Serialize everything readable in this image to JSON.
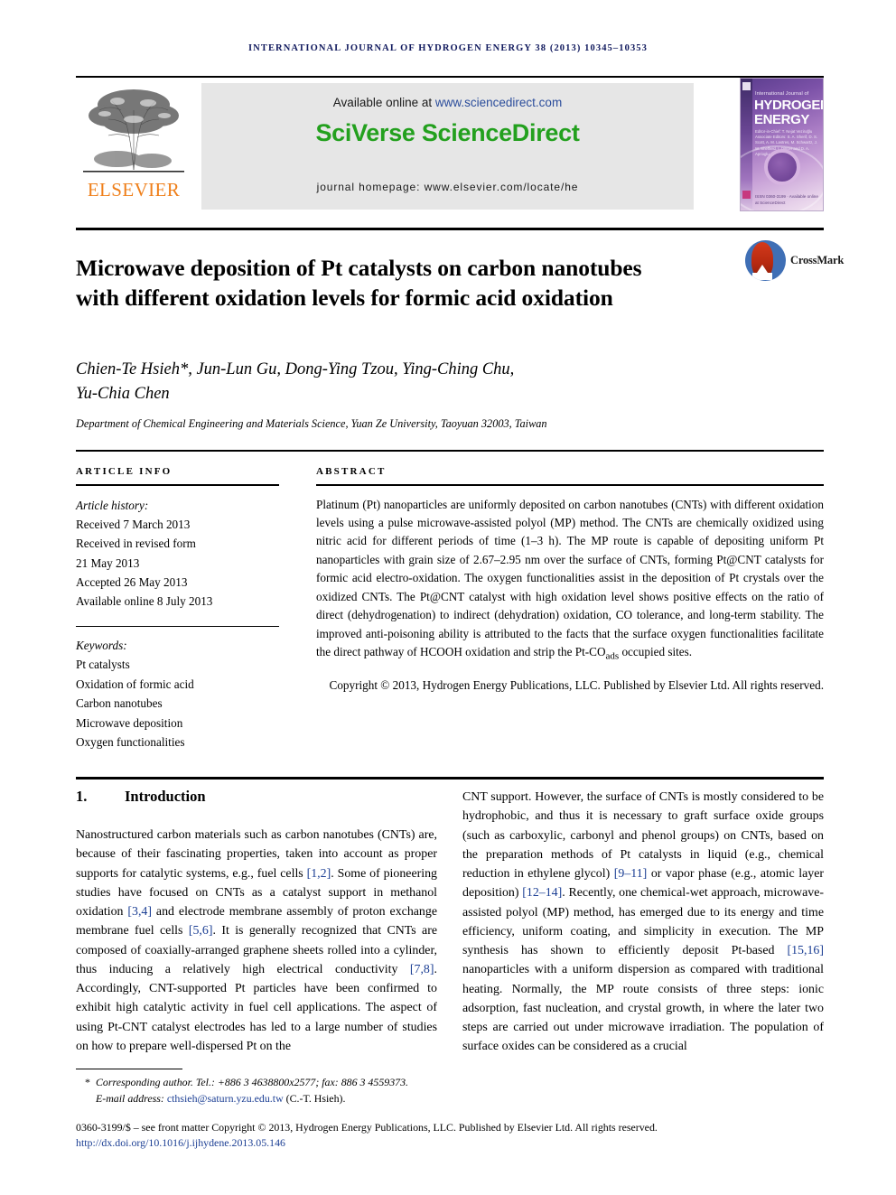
{
  "running_head": "International Journal of Hydrogen Energy 38 (2013) 10345–10353",
  "masthead": {
    "available_prefix": "Available online at ",
    "sciencedirect_url": "www.sciencedirect.com",
    "sciverse_logo": "SciVerse ScienceDirect",
    "journal_homepage": "journal homepage: www.elsevier.com/locate/he",
    "publisher_wordmark": "ELSEVIER",
    "cover": {
      "sub": "International Journal of",
      "line1": "HYDROGEN",
      "line2": "ENERGY",
      "editors": "Editor-in-Chief:  T. Nejat Veziroğlu\nAssociate Editors:  S. A. Sherif, D. S. Scott, A. M. Lastres, M. Schwartz, J. W. Sheffield, I. Dincer and D. A. Aprioglu",
      "footer": "ISSN 0360-3199 · Available online at\nScienceDirect"
    }
  },
  "article": {
    "title": "Microwave deposition of Pt catalysts on carbon nanotubes with different oxidation levels for formic acid oxidation",
    "crossmark_label": "CrossMark",
    "authors_line1": "Chien-Te Hsieh*, Jun-Lun Gu, Dong-Ying Tzou, Ying-Ching Chu,",
    "authors_line2": "Yu-Chia Chen",
    "affiliation": "Department of Chemical Engineering and Materials Science, Yuan Ze University, Taoyuan 32003, Taiwan"
  },
  "info": {
    "heading": "ARTICLE INFO",
    "history_label": "Article history:",
    "history": [
      "Received 7 March 2013",
      "Received in revised form",
      "21 May 2013",
      "Accepted 26 May 2013",
      "Available online 8 July 2013"
    ],
    "keywords_label": "Keywords:",
    "keywords": [
      "Pt catalysts",
      "Oxidation of formic acid",
      "Carbon nanotubes",
      "Microwave deposition",
      "Oxygen functionalities"
    ]
  },
  "abstract": {
    "heading": "ABSTRACT",
    "body": "Platinum (Pt) nanoparticles are uniformly deposited on carbon nanotubes (CNTs) with different oxidation levels using a pulse microwave-assisted polyol (MP) method. The CNTs are chemically oxidized using nitric acid for different periods of time (1–3 h). The MP route is capable of depositing uniform Pt nanoparticles with grain size of 2.67–2.95 nm over the surface of CNTs, forming Pt@CNT catalysts for formic acid electro-oxidation. The oxygen functionalities assist in the deposition of Pt crystals over the oxidized CNTs. The Pt@CNT catalyst with high oxidation level shows positive effects on the ratio of direct (dehydrogenation) to indirect (dehydration) oxidation, CO tolerance, and long-term stability. The improved anti-poisoning ability is attributed to the facts that the surface oxygen functionalities facilitate the direct pathway of HCOOH oxidation and strip the Pt-CO",
    "body_sub": "ads",
    "body_tail": " occupied sites.",
    "copyright": "Copyright © 2013, Hydrogen Energy Publications, LLC. Published by Elsevier Ltd. All rights reserved."
  },
  "introduction": {
    "number": "1.",
    "heading": "Introduction",
    "left_segments": [
      {
        "t": "Nanostructured carbon materials such as carbon nanotubes (CNTs) are, because of their fascinating properties, taken into account as proper supports for catalytic systems, e.g., fuel cells ",
        "ref": false
      },
      {
        "t": "[1,2]",
        "ref": true
      },
      {
        "t": ". Some of pioneering studies have focused on CNTs as a catalyst support in methanol oxidation ",
        "ref": false
      },
      {
        "t": "[3,4]",
        "ref": true
      },
      {
        "t": " and electrode membrane assembly of proton exchange membrane fuel cells ",
        "ref": false
      },
      {
        "t": "[5,6]",
        "ref": true
      },
      {
        "t": ". It is generally recognized that CNTs are composed of coaxially-arranged graphene sheets rolled into a cylinder, thus inducing a relatively high electrical conductivity ",
        "ref": false
      },
      {
        "t": "[7,8]",
        "ref": true
      },
      {
        "t": ". Accordingly, CNT-supported Pt particles have been confirmed to exhibit high catalytic activity in fuel cell applications. The aspect of using Pt-CNT catalyst electrodes has led to a large number of studies on how to prepare well-dispersed Pt on the",
        "ref": false
      }
    ],
    "right_segments": [
      {
        "t": "CNT support. However, the surface of CNTs is mostly considered to be hydrophobic, and thus it is necessary to graft surface oxide groups (such as carboxylic, carbonyl and phenol groups) on CNTs, based on the preparation methods of Pt catalysts in liquid (e.g., chemical reduction in ethylene glycol) ",
        "ref": false
      },
      {
        "t": "[9–11]",
        "ref": true
      },
      {
        "t": " or vapor phase (e.g., atomic layer deposition) ",
        "ref": false
      },
      {
        "t": "[12–14]",
        "ref": true
      },
      {
        "t": ". Recently, one chemical-wet approach, microwave-assisted polyol (MP) method, has emerged due to its energy and time efficiency, uniform coating, and simplicity in execution. The MP synthesis has shown to efficiently deposit Pt-based ",
        "ref": false
      },
      {
        "t": "[15,16]",
        "ref": true
      },
      {
        "t": " nanoparticles with a uniform dispersion as compared with traditional heating. Normally, the MP route consists of three steps: ionic adsorption, fast nucleation, and crystal growth, in where the later two steps are carried out under microwave irradiation. The population of surface oxides can be considered as a crucial",
        "ref": false
      }
    ]
  },
  "footer": {
    "corresponding": "Corresponding author. Tel.: +886 3 4638800x2577; fax: 886 3 4559373.",
    "email_label": "E-mail address: ",
    "email": "cthsieh@saturn.yzu.edu.tw",
    "email_suffix": " (C.-T. Hsieh).",
    "issn_line": "0360-3199/$ – see front matter Copyright © 2013, Hydrogen Energy Publications, LLC. Published by Elsevier Ltd. All rights reserved.",
    "doi": "http://dx.doi.org/10.1016/j.ijhydene.2013.05.146"
  },
  "colors": {
    "running_head": "#111a5e",
    "elsevier_orange": "#ef7f1a",
    "sciencedirect_green": "#23a01e",
    "link_blue": "#1c3f94"
  }
}
